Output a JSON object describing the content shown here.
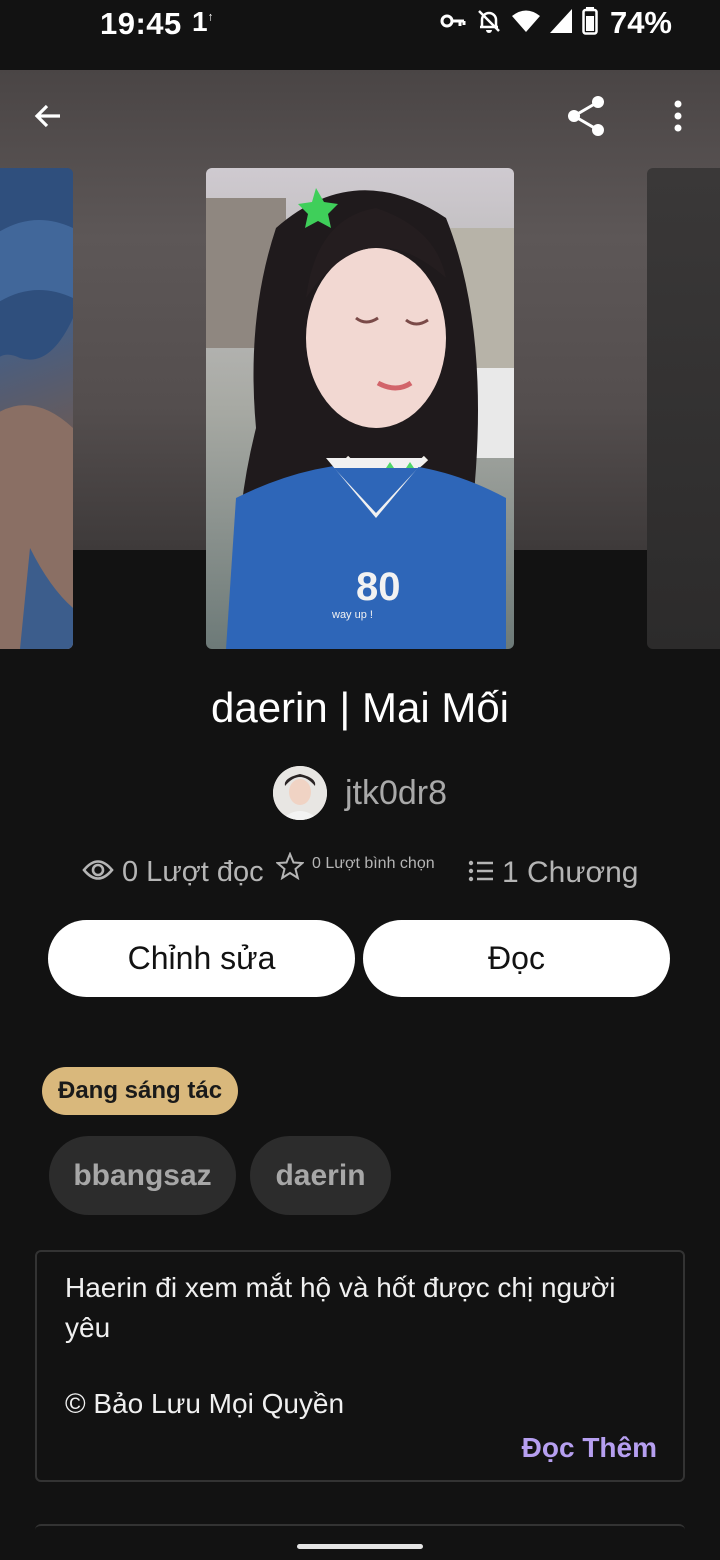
{
  "status_bar": {
    "time": "19:45",
    "indicator": "1",
    "battery": "74%",
    "icons": [
      "vpn-key-icon",
      "bell-off-icon",
      "wifi-icon",
      "signal-icon",
      "battery-icon"
    ]
  },
  "toolbar": {
    "back_icon": "arrow-left-icon",
    "share_icon": "share-icon",
    "more_icon": "more-vert-icon"
  },
  "story": {
    "title": "daerin | Mai Mối",
    "author": "jtk0dr8"
  },
  "stats": {
    "reads": "0 Lượt đọc",
    "votes": "0 Lượt bình chọn",
    "parts": "1 Chương"
  },
  "actions": {
    "edit_label": "Chỉnh sửa",
    "read_label": "Đọc"
  },
  "status_badge": "Đang sáng tác",
  "tags": [
    "bbangsaz",
    "daerin"
  ],
  "description": {
    "text": "Haerin đi xem mắt hộ và hốt được chị người yêu",
    "copyright": "© Bảo Lưu Mọi Quyền",
    "read_more": "Đọc Thêm"
  },
  "colors": {
    "background": "#121212",
    "badge": "#d9b87c",
    "accent": "#b69ff0",
    "chip": "#2c2c2c"
  }
}
